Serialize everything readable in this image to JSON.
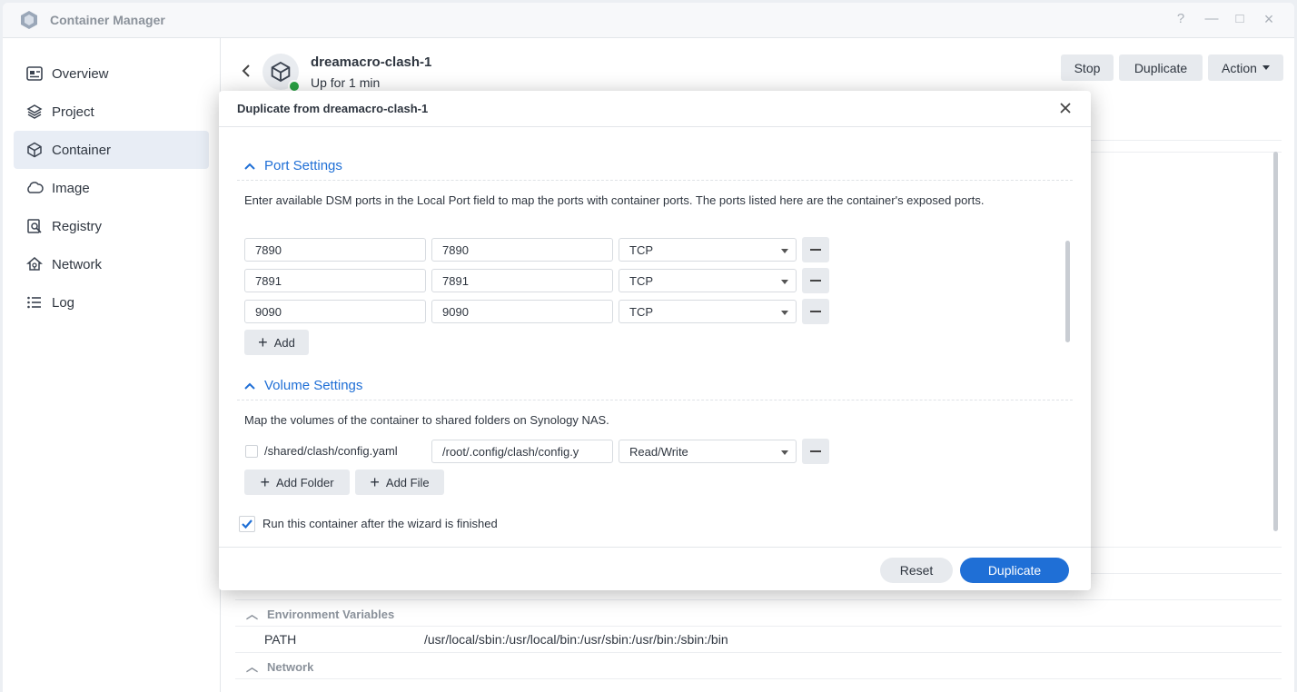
{
  "app": {
    "title": "Container Manager",
    "window_controls": [
      "?",
      "—",
      "□",
      "×"
    ]
  },
  "sidebar": {
    "items": [
      {
        "label": "Overview",
        "icon": "overview-icon"
      },
      {
        "label": "Project",
        "icon": "project-icon"
      },
      {
        "label": "Container",
        "icon": "container-icon",
        "active": true
      },
      {
        "label": "Image",
        "icon": "image-icon"
      },
      {
        "label": "Registry",
        "icon": "registry-icon"
      },
      {
        "label": "Network",
        "icon": "network-icon"
      },
      {
        "label": "Log",
        "icon": "log-icon"
      }
    ]
  },
  "container": {
    "name": "dreamacro-clash-1",
    "status": "Up for 1 min",
    "status_color": "#2aa243",
    "buttons": {
      "stop": "Stop",
      "duplicate": "Duplicate",
      "action": "Action"
    }
  },
  "background": {
    "env_section": "Environment Variables",
    "env_key": "PATH",
    "env_value": "/usr/local/sbin:/usr/local/bin:/usr/sbin:/usr/bin:/sbin:/bin",
    "network_section": "Network"
  },
  "dialog": {
    "title": "Duplicate from dreamacro-clash-1",
    "port_section": "Port Settings",
    "port_desc": "Enter available DSM ports in the Local Port field to map the ports with container ports. The ports listed here are the container's exposed ports.",
    "ports": [
      {
        "local": "7890",
        "container": "7890",
        "protocol": "TCP"
      },
      {
        "local": "7891",
        "container": "7891",
        "protocol": "TCP"
      },
      {
        "local": "9090",
        "container": "9090",
        "protocol": "TCP"
      }
    ],
    "add_label": "Add",
    "volume_section": "Volume Settings",
    "volume_desc": "Map the volumes of the container to shared folders on Synology NAS.",
    "volumes": [
      {
        "host": "/shared/clash/config.yaml",
        "mount": "/root/.config/clash/config.y",
        "mode": "Read/Write"
      }
    ],
    "add_folder_label": "Add Folder",
    "add_file_label": "Add File",
    "run_after_label": "Run this container after the wizard is finished",
    "run_after_checked": true,
    "reset_label": "Reset",
    "duplicate_label": "Duplicate"
  },
  "colors": {
    "accent": "#1f6fd6",
    "sidebar_active": "#e8edf5"
  }
}
